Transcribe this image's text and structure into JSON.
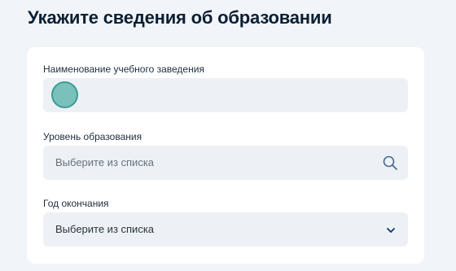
{
  "page": {
    "title": "Укажите сведения об образовании"
  },
  "form": {
    "institution": {
      "label": "Наименование учебного заведения",
      "state": "loading",
      "loader_color": "#7ac0bb"
    },
    "education_level": {
      "label": "Уровень образования",
      "placeholder": "Выберите из списка",
      "icon": "search-icon"
    },
    "graduation_year": {
      "label": "Год окончания",
      "value": "Выберите из списка",
      "icon": "chevron-down-icon"
    }
  },
  "colors": {
    "background": "#f1f4f8",
    "card": "#ffffff",
    "field": "#edf1f5",
    "accent": "#0d4cd3",
    "icon": "#4a6a8a"
  }
}
